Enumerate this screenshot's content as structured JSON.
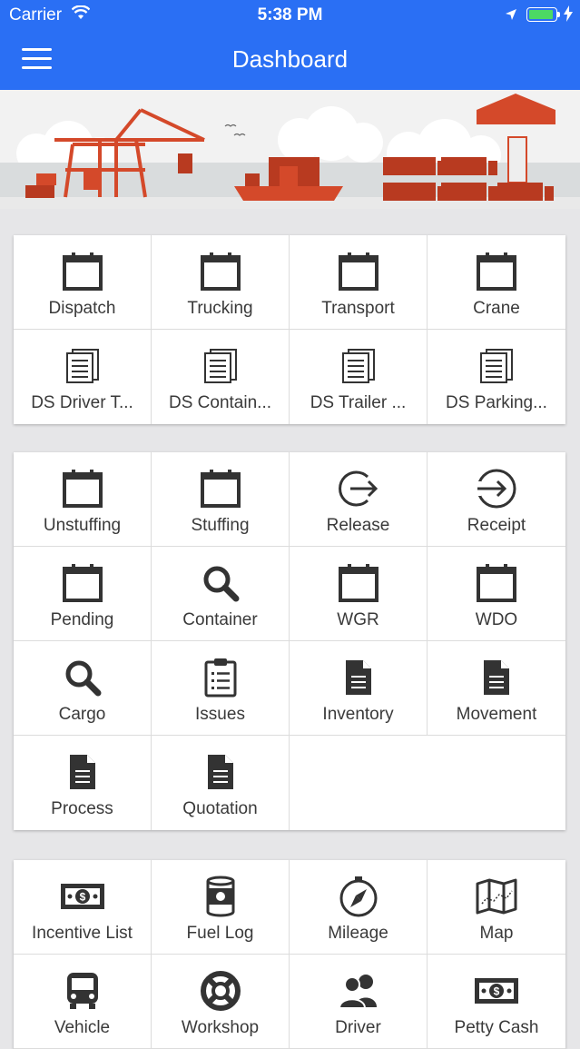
{
  "status_bar": {
    "carrier": "Carrier",
    "time": "5:38 PM"
  },
  "nav": {
    "title": "Dashboard"
  },
  "colors": {
    "primary": "#2a6ff4",
    "icon": "#333333",
    "banner_accent": "#d4492a"
  },
  "sections": [
    {
      "tiles": [
        {
          "label": "Dispatch",
          "icon": "calendar-icon"
        },
        {
          "label": "Trucking",
          "icon": "calendar-icon"
        },
        {
          "label": "Transport",
          "icon": "calendar-icon"
        },
        {
          "label": "Crane",
          "icon": "calendar-icon"
        },
        {
          "label": "DS Driver T...",
          "icon": "list-document-icon"
        },
        {
          "label": "DS Contain...",
          "icon": "list-document-icon"
        },
        {
          "label": "DS Trailer ...",
          "icon": "list-document-icon"
        },
        {
          "label": "DS Parking...",
          "icon": "list-document-icon"
        }
      ]
    },
    {
      "tiles": [
        {
          "label": "Unstuffing",
          "icon": "calendar-icon"
        },
        {
          "label": "Stuffing",
          "icon": "calendar-icon"
        },
        {
          "label": "Release",
          "icon": "sign-out-icon"
        },
        {
          "label": "Receipt",
          "icon": "sign-in-icon"
        },
        {
          "label": "Pending",
          "icon": "calendar-icon"
        },
        {
          "label": "Container",
          "icon": "search-icon"
        },
        {
          "label": "WGR",
          "icon": "calendar-icon"
        },
        {
          "label": "WDO",
          "icon": "calendar-icon"
        },
        {
          "label": "Cargo",
          "icon": "search-icon"
        },
        {
          "label": "Issues",
          "icon": "clipboard-icon"
        },
        {
          "label": "Inventory",
          "icon": "document-icon"
        },
        {
          "label": "Movement",
          "icon": "document-icon"
        },
        {
          "label": "Process",
          "icon": "document-icon"
        },
        {
          "label": "Quotation",
          "icon": "document-icon"
        }
      ]
    },
    {
      "tiles": [
        {
          "label": "Incentive List",
          "icon": "cash-icon"
        },
        {
          "label": "Fuel Log",
          "icon": "fuel-can-icon"
        },
        {
          "label": "Mileage",
          "icon": "compass-icon"
        },
        {
          "label": "Map",
          "icon": "map-icon"
        },
        {
          "label": "Vehicle",
          "icon": "bus-icon"
        },
        {
          "label": "Workshop",
          "icon": "lifebuoy-icon"
        },
        {
          "label": "Driver",
          "icon": "users-icon"
        },
        {
          "label": "Petty Cash",
          "icon": "cash-icon"
        }
      ]
    }
  ]
}
